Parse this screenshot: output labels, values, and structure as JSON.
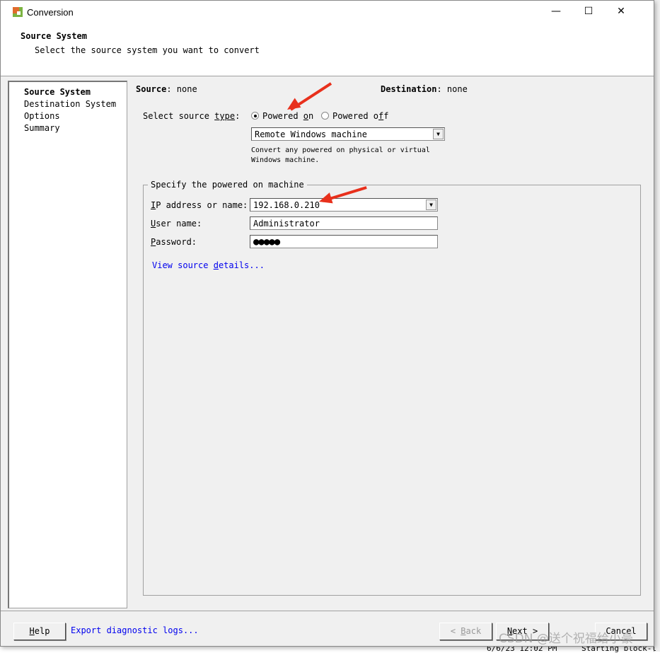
{
  "window": {
    "title": "Conversion",
    "minimize": "—",
    "maximize": "☐",
    "close": "✕"
  },
  "header": {
    "title": "Source System",
    "subtitle": "Select the source system you want to convert"
  },
  "nav": {
    "items": [
      {
        "label": "Source System",
        "active": true
      },
      {
        "label": "Destination System"
      },
      {
        "label": "Options"
      },
      {
        "label": "Summary"
      }
    ]
  },
  "summary": {
    "source_label": "Source",
    "source_value": ": none",
    "dest_label": "Destination",
    "dest_value": ": none"
  },
  "source_type": {
    "label_pre": "Select source ",
    "label_u": "type",
    "label_post": ":",
    "options": [
      {
        "label_pre": "Powered ",
        "label_u": "o",
        "label_post": "n",
        "selected": true
      },
      {
        "label_pre": "Powered o",
        "label_u": "f",
        "label_post": "f",
        "selected": false
      }
    ],
    "machine_type": "Remote Windows machine",
    "description_1": "Convert any powered on physical or virtual",
    "description_2": "Windows machine."
  },
  "group": {
    "legend": "Specify the powered on machine",
    "ip_label_u": "I",
    "ip_label": "P address or name:",
    "ip_value": "192.168.0.210",
    "user_label_u": "U",
    "user_label": "ser name:",
    "user_value": "Administrator",
    "pw_label_u": "P",
    "pw_label": "assword:",
    "pw_value": "●●●●●",
    "link_pre": "View source ",
    "link_u": "d",
    "link_post": "etails..."
  },
  "footer": {
    "help_u": "H",
    "help": "elp",
    "export": "Export diagnostic logs...",
    "back_pre": "< ",
    "back_u": "B",
    "back": "ack",
    "next_u": "N",
    "next": "ext >",
    "cancel": "Cancel"
  },
  "background": {
    "log_time": "6/6/23 12:02 PM",
    "log_text": "Starting block-l"
  },
  "watermark": "CSDN @送个祝福给小豪",
  "colors": {
    "link": "#0000ee",
    "annotation_arrow": "#e8301c"
  }
}
